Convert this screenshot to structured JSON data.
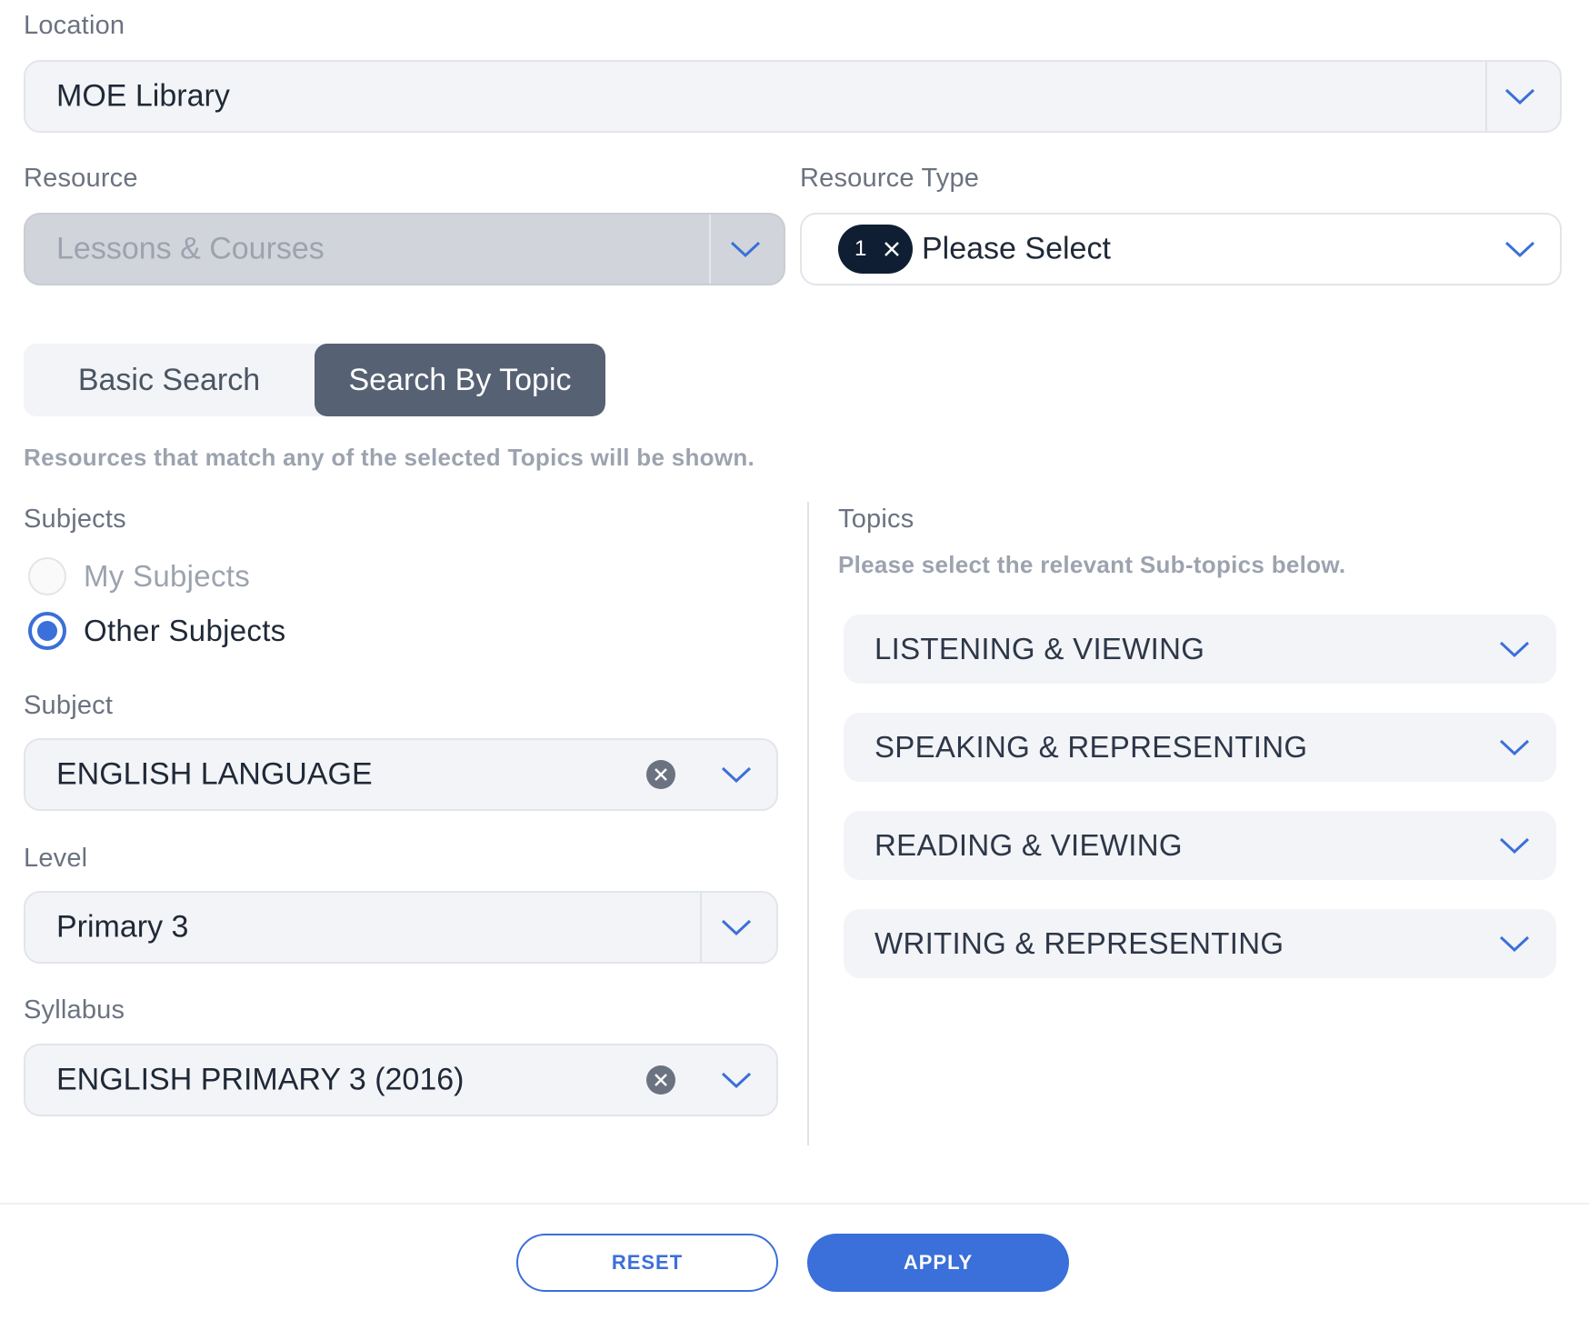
{
  "location": {
    "label": "Location",
    "value": "MOE Library"
  },
  "resource": {
    "label": "Resource",
    "value": "Lessons & Courses"
  },
  "resource_type": {
    "label": "Resource Type",
    "chip_count": "1",
    "value": "Please Select"
  },
  "search_mode": {
    "basic": "Basic Search",
    "topic": "Search By Topic",
    "selected": "Search By Topic"
  },
  "hint": "Resources that match any of the selected Topics will be shown.",
  "subjects": {
    "label": "Subjects",
    "options": [
      "My Subjects",
      "Other Subjects"
    ],
    "selected": "Other Subjects"
  },
  "subject": {
    "label": "Subject",
    "value": "ENGLISH LANGUAGE"
  },
  "level": {
    "label": "Level",
    "value": "Primary 3"
  },
  "syllabus": {
    "label": "Syllabus",
    "value": "ENGLISH PRIMARY 3 (2016)"
  },
  "topics": {
    "label": "Topics",
    "hint": "Please select the relevant Sub-topics below.",
    "items": [
      "LISTENING & VIEWING",
      "SPEAKING & REPRESENTING",
      "READING & VIEWING",
      "WRITING & REPRESENTING"
    ]
  },
  "actions": {
    "reset": "RESET",
    "apply": "APPLY"
  },
  "colors": {
    "accent": "#3b6fd9",
    "chip": "#0f1e33",
    "segment_active": "#566173"
  }
}
